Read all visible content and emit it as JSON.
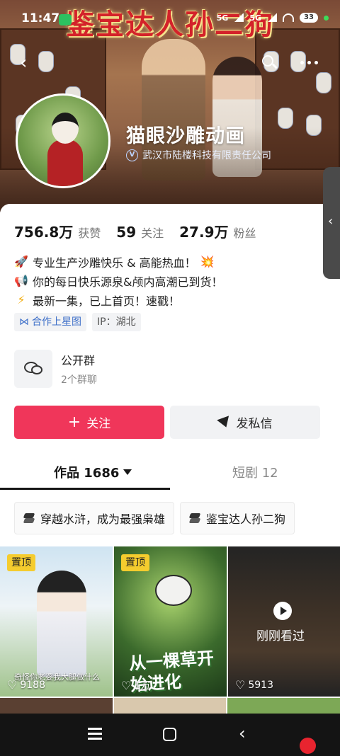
{
  "status_bar": {
    "time": "11:47",
    "battery": "33",
    "signal1": "5G",
    "signal2": "5G"
  },
  "banner": {
    "title": "鉴宝达人孙二狗"
  },
  "profile": {
    "name": "猫眼沙雕动画",
    "verified_org": "武汉市陆楼科技有限责任公司",
    "verify_badge": "V"
  },
  "stats": [
    {
      "value": "756.8万",
      "label": "获赞"
    },
    {
      "value": "59",
      "label": "关注"
    },
    {
      "value": "27.9万",
      "label": "粉丝"
    }
  ],
  "bio": {
    "line1": "专业生产沙雕快乐 & 高能热血！",
    "line2": "你的每日快乐源泉&颅内高潮已到货！",
    "line3": "最新一集，已上首页！速戳！",
    "emoji_rocket": "🚀",
    "emoji_horn": "📢",
    "emoji_bolt": "⚡",
    "emoji_boom": "💥"
  },
  "tags": {
    "star_label": "合作上星图",
    "ip_label": "IP：湖北"
  },
  "group": {
    "title": "公开群",
    "subtitle": "2个群聊"
  },
  "actions": {
    "follow_label": "关注",
    "follow_plus": "+",
    "message_label": "发私信"
  },
  "tabs": {
    "works_label": "作品 1686",
    "shorts_label": "短剧 12"
  },
  "collections": [
    {
      "label": "穿越水浒，成为最强枭雄"
    },
    {
      "label": "鉴宝达人孙二狗"
    }
  ],
  "videos": [
    {
      "pinned": "置顶",
      "likes": "9188",
      "caption": "奇怪你老婆我大腿做什么"
    },
    {
      "pinned": "置顶",
      "likes": "1万",
      "caption": "从一棵草开始进化"
    },
    {
      "overlay": "刚刚看过",
      "likes": "5913"
    }
  ],
  "colors": {
    "follow_button": "#f0365a",
    "pinned_badge": "#f5cc2e",
    "star_tag": "#3f70c9",
    "banner_title": "#d3222a"
  },
  "icons": {
    "back": "back-arrow-icon",
    "search": "search-icon",
    "more": "more-dots-icon",
    "group": "chat-bubbles-icon",
    "send": "paper-plane-icon"
  }
}
